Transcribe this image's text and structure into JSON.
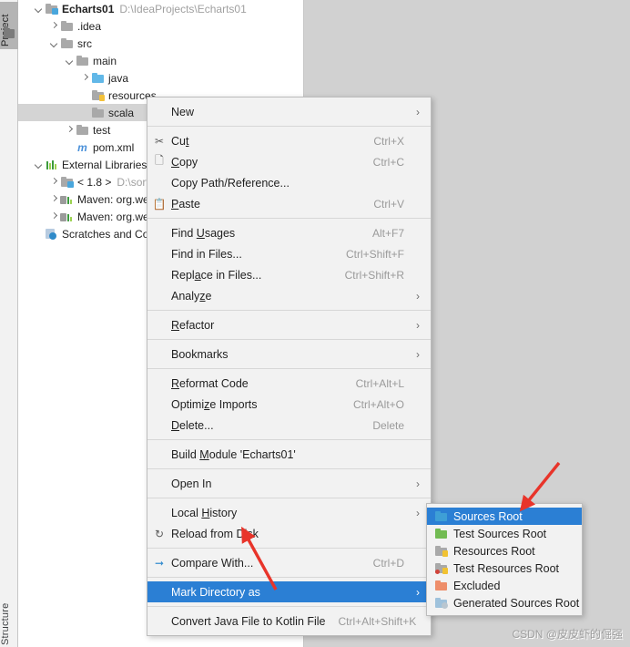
{
  "toolwindow": {
    "project_tab": "Project",
    "structure_tab": "Structure"
  },
  "project_tree": [
    {
      "indent": 1,
      "arrow": "open",
      "icon": "module",
      "label": "Echarts01",
      "bold": true,
      "path": "D:\\IdeaProjects\\Echarts01",
      "selected": false
    },
    {
      "indent": 2,
      "arrow": "closed",
      "icon": "gray",
      "label": ".idea",
      "bold": false,
      "path": "",
      "selected": false
    },
    {
      "indent": 2,
      "arrow": "open",
      "icon": "gray",
      "label": "src",
      "bold": false,
      "path": "",
      "selected": false
    },
    {
      "indent": 3,
      "arrow": "open",
      "icon": "gray",
      "label": "main",
      "bold": false,
      "path": "",
      "selected": false
    },
    {
      "indent": 4,
      "arrow": "closed",
      "icon": "blue",
      "label": "java",
      "bold": false,
      "path": "",
      "selected": false
    },
    {
      "indent": 4,
      "arrow": "none",
      "icon": "res",
      "label": "resources",
      "bold": false,
      "path": "",
      "selected": false
    },
    {
      "indent": 4,
      "arrow": "none",
      "icon": "gray",
      "label": "scala",
      "bold": false,
      "path": "",
      "selected": true
    },
    {
      "indent": 3,
      "arrow": "closed",
      "icon": "gray",
      "label": "test",
      "bold": false,
      "path": "",
      "selected": false
    },
    {
      "indent": 3,
      "arrow": "none",
      "icon": "maven-m",
      "label": "pom.xml",
      "bold": false,
      "path": "",
      "selected": false
    },
    {
      "indent": 1,
      "arrow": "open",
      "icon": "library",
      "label": "External Libraries",
      "bold": false,
      "path": "",
      "selected": false
    },
    {
      "indent": 2,
      "arrow": "closed",
      "icon": "sdk",
      "label": "< 1.8 >",
      "bold": false,
      "path": "D:\\sorft",
      "selected": false
    },
    {
      "indent": 2,
      "arrow": "closed",
      "icon": "mvn",
      "label": "Maven: org.web",
      "bold": false,
      "path": "",
      "selected": false
    },
    {
      "indent": 2,
      "arrow": "closed",
      "icon": "mvn",
      "label": "Maven: org.web",
      "bold": false,
      "path": "",
      "selected": false
    },
    {
      "indent": 1,
      "arrow": "none",
      "icon": "scratch",
      "label": "Scratches and Cons",
      "bold": false,
      "path": "",
      "selected": false
    }
  ],
  "context_menu": {
    "items": [
      {
        "type": "item",
        "icon": "",
        "label": "New",
        "shortcut": "",
        "submenu": true,
        "selected": false,
        "mnemonic": ""
      },
      {
        "type": "sep"
      },
      {
        "type": "item",
        "icon": "scissors",
        "label": "Cut",
        "shortcut": "Ctrl+X",
        "submenu": false,
        "selected": false,
        "mnemonic": "t"
      },
      {
        "type": "item",
        "icon": "copy",
        "label": "Copy",
        "shortcut": "Ctrl+C",
        "submenu": false,
        "selected": false,
        "mnemonic": "C"
      },
      {
        "type": "item",
        "icon": "",
        "label": "Copy Path/Reference...",
        "shortcut": "",
        "submenu": false,
        "selected": false,
        "mnemonic": ""
      },
      {
        "type": "item",
        "icon": "paste",
        "label": "Paste",
        "shortcut": "Ctrl+V",
        "submenu": false,
        "selected": false,
        "mnemonic": "P"
      },
      {
        "type": "sep"
      },
      {
        "type": "item",
        "icon": "",
        "label": "Find Usages",
        "shortcut": "Alt+F7",
        "submenu": false,
        "selected": false,
        "mnemonic": "U"
      },
      {
        "type": "item",
        "icon": "",
        "label": "Find in Files...",
        "shortcut": "Ctrl+Shift+F",
        "submenu": false,
        "selected": false,
        "mnemonic": ""
      },
      {
        "type": "item",
        "icon": "",
        "label": "Replace in Files...",
        "shortcut": "Ctrl+Shift+R",
        "submenu": false,
        "selected": false,
        "mnemonic": "a"
      },
      {
        "type": "item",
        "icon": "",
        "label": "Analyze",
        "shortcut": "",
        "submenu": true,
        "selected": false,
        "mnemonic": "z"
      },
      {
        "type": "sep"
      },
      {
        "type": "item",
        "icon": "",
        "label": "Refactor",
        "shortcut": "",
        "submenu": true,
        "selected": false,
        "mnemonic": "R"
      },
      {
        "type": "sep"
      },
      {
        "type": "item",
        "icon": "",
        "label": "Bookmarks",
        "shortcut": "",
        "submenu": true,
        "selected": false,
        "mnemonic": ""
      },
      {
        "type": "sep"
      },
      {
        "type": "item",
        "icon": "",
        "label": "Reformat Code",
        "shortcut": "Ctrl+Alt+L",
        "submenu": false,
        "selected": false,
        "mnemonic": "R"
      },
      {
        "type": "item",
        "icon": "",
        "label": "Optimize Imports",
        "shortcut": "Ctrl+Alt+O",
        "submenu": false,
        "selected": false,
        "mnemonic": "z"
      },
      {
        "type": "item",
        "icon": "",
        "label": "Delete...",
        "shortcut": "Delete",
        "submenu": false,
        "selected": false,
        "mnemonic": "D"
      },
      {
        "type": "sep"
      },
      {
        "type": "item",
        "icon": "",
        "label": "Build Module 'Echarts01'",
        "shortcut": "",
        "submenu": false,
        "selected": false,
        "mnemonic": "M"
      },
      {
        "type": "sep"
      },
      {
        "type": "item",
        "icon": "",
        "label": "Open In",
        "shortcut": "",
        "submenu": true,
        "selected": false,
        "mnemonic": ""
      },
      {
        "type": "sep"
      },
      {
        "type": "item",
        "icon": "",
        "label": "Local History",
        "shortcut": "",
        "submenu": true,
        "selected": false,
        "mnemonic": "H"
      },
      {
        "type": "item",
        "icon": "reload",
        "label": "Reload from Disk",
        "shortcut": "",
        "submenu": false,
        "selected": false,
        "mnemonic": ""
      },
      {
        "type": "sep"
      },
      {
        "type": "item",
        "icon": "compare",
        "label": "Compare With...",
        "shortcut": "Ctrl+D",
        "submenu": false,
        "selected": false,
        "mnemonic": ""
      },
      {
        "type": "sep"
      },
      {
        "type": "item",
        "icon": "",
        "label": "Mark Directory as",
        "shortcut": "",
        "submenu": true,
        "selected": true,
        "mnemonic": ""
      },
      {
        "type": "sep"
      },
      {
        "type": "item",
        "icon": "",
        "label": "Convert Java File to Kotlin File",
        "shortcut": "Ctrl+Alt+Shift+K",
        "submenu": false,
        "selected": false,
        "mnemonic": ""
      }
    ]
  },
  "submenu": {
    "items": [
      {
        "label": "Sources Root",
        "color": "c-blue",
        "badge": "none",
        "selected": true
      },
      {
        "label": "Test Sources Root",
        "color": "c-green",
        "badge": "none",
        "selected": false
      },
      {
        "label": "Resources Root",
        "color": "c-gray",
        "badge": "yellow",
        "selected": false
      },
      {
        "label": "Test Resources Root",
        "color": "c-gray",
        "badge": "redgreen",
        "selected": false
      },
      {
        "label": "Excluded",
        "color": "c-orange",
        "badge": "none",
        "selected": false
      },
      {
        "label": "Generated Sources Root",
        "color": "c-bluegray",
        "badge": "gear",
        "selected": false
      }
    ]
  },
  "annotations": {
    "arrow_color": "#e8342a",
    "arrow_to_sources_root": "arrow pointing at Sources Root",
    "arrow_to_mark_directory": "arrow pointing at Mark Directory as"
  },
  "watermark": {
    "text": "CSDN @皮皮虾的倔强"
  }
}
